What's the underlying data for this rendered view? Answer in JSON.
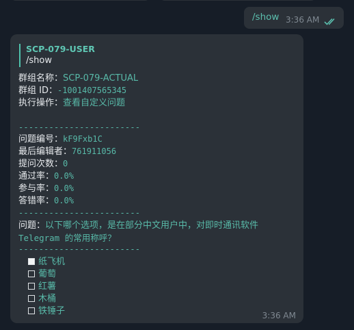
{
  "outgoing": {
    "text": "/show",
    "time": "3:36 AM"
  },
  "incoming": {
    "reply_name": "SCP-079-USER",
    "reply_text": "/show",
    "group_name_label": "群组名称：",
    "group_name_value": "SCP-079-ACTUAL",
    "group_id_label": "群组 ID：",
    "group_id_value": "-1001407565345",
    "action_label": "执行操作：",
    "action_value": "查看自定义问题",
    "divider": "------------------------",
    "question_id_label": "问题编号：",
    "question_id_value": "kF9Fxb1C",
    "editor_label": "最后编辑者：",
    "editor_value": "761911056",
    "ask_count_label": "提问次数：",
    "ask_count_value": "0",
    "pass_rate_label": "通过率：",
    "pass_rate_value": "0.0%",
    "participation_label": "参与率：",
    "participation_value": "0.0%",
    "error_rate_label": "答错率：",
    "error_rate_value": "0.0%",
    "question_label": "问题：",
    "question_line1": "以下哪个选项，是在部分中文用户中，对即时通讯软件",
    "question_line2": "Telegram 的常用称呼？",
    "options": [
      {
        "label": "纸飞机",
        "checked": true
      },
      {
        "label": "葡萄",
        "checked": false
      },
      {
        "label": "红薯",
        "checked": false
      },
      {
        "label": "木桶",
        "checked": false
      },
      {
        "label": "铁锤子",
        "checked": false
      }
    ],
    "time": "3:36 AM"
  }
}
